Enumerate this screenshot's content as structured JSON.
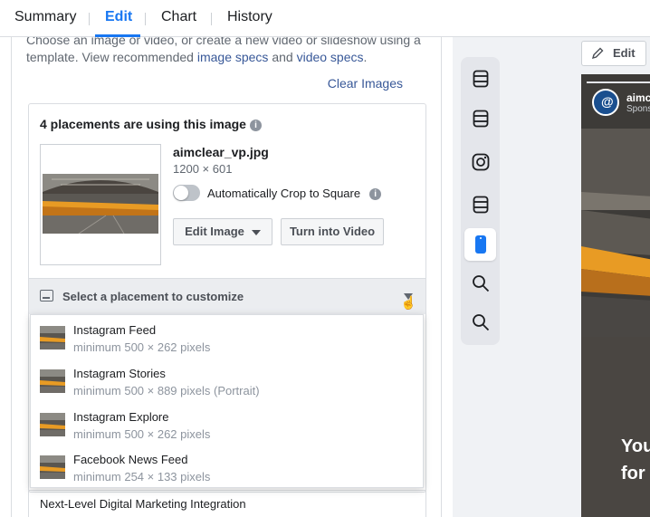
{
  "tabs": [
    {
      "label": "Summary"
    },
    {
      "label": "Edit"
    },
    {
      "label": "Chart"
    },
    {
      "label": "History"
    }
  ],
  "active_tab": "Edit",
  "intro": {
    "line1": "Choose an image or video, or create a new video or slideshow using a",
    "line2_prefix": "template. View recommended ",
    "image_specs_link": "image specs",
    "and": " and ",
    "video_specs_link": "video specs",
    "period": "."
  },
  "clear_images": "Clear Images",
  "image_card": {
    "title": "4 placements are using this image",
    "file_name": "aimclear_vp.jpg",
    "dimensions": "1200 × 601",
    "auto_crop_label": "Automatically Crop to Square",
    "auto_crop_on": false,
    "edit_image_button": "Edit Image",
    "turn_into_video_button": "Turn into Video"
  },
  "placement_select": {
    "label": "Select a placement to customize"
  },
  "placements": [
    {
      "name": "Instagram Feed",
      "size": "minimum 500 × 262 pixels"
    },
    {
      "name": "Instagram Stories",
      "size": "minimum 500 × 889 pixels (Portrait)"
    },
    {
      "name": "Instagram Explore",
      "size": "minimum 500 × 262 pixels"
    },
    {
      "name": "Facebook News Feed",
      "size": "minimum 254 × 133 pixels"
    }
  ],
  "headline_value": "Next-Level Digital Marketing Integration",
  "preview": {
    "edit_button": "Edit",
    "account_name": "aimc",
    "sponsored": "Spons",
    "story_text_line1": "You",
    "story_text_line2": "for"
  },
  "colors": {
    "accent": "#1877f2",
    "link": "#385898",
    "active_rail_icon": "#1877f2"
  },
  "rail_icons": [
    "feed-icon",
    "feed-icon",
    "instagram-icon",
    "feed-icon",
    "phone-story-icon",
    "search-icon",
    "search-icon"
  ]
}
